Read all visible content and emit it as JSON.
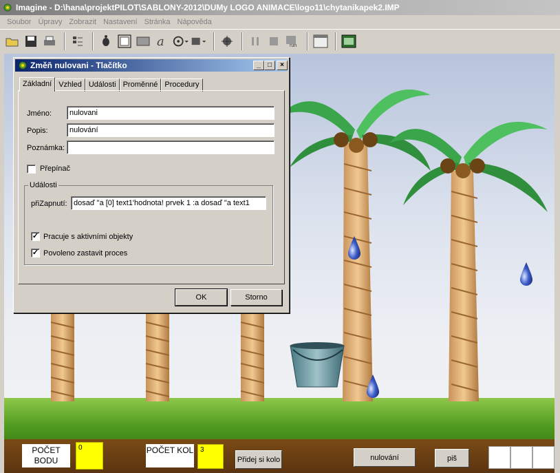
{
  "window": {
    "title": "Imagine - D:\\hana\\projektPILOT\\SABLONY-2012\\DUMy LOGO ANIMACE\\logo11\\chytanikapek2.IMP"
  },
  "menu": [
    "Soubor",
    "Úpravy",
    "Zobrazit",
    "Nastavení",
    "Stránka",
    "Nápověda"
  ],
  "toolbar": {
    "icons": [
      "open-folder-icon",
      "save-icon",
      "print-icon",
      "grid-icon",
      "turtle-icon",
      "frame-icon",
      "rectangle-icon",
      "text-a-icon",
      "film-icon",
      "slider-icon",
      "run-icon",
      "pause-icon",
      "stop-icon",
      "run-label-icon",
      "window-icon",
      "screen-icon"
    ]
  },
  "dialog": {
    "title": "Změň nulovani  - Tlačítko",
    "tabs": [
      "Základní",
      "Vzhled",
      "Události",
      "Proměnné",
      "Procedury"
    ],
    "fields": {
      "name_label": "Jméno:",
      "name_value": "nulovani",
      "desc_label": "Popis:",
      "desc_value": "nulování",
      "note_label": "Poznámka:",
      "note_value": ""
    },
    "switch_label": "Přepínač",
    "events_group": "Události",
    "onpress_label": "přiZapnutí:",
    "onpress_value": "dosaď \"a [0] text1'hodnota! prvek 1 :a dosaď \"a text1",
    "active_objects_label": "Pracuje s aktivními objekty",
    "allow_stop_label": "Povoleno zastavit proces",
    "ok_label": "OK",
    "cancel_label": "Storno"
  },
  "scene": {
    "points_label": "POČET BODU",
    "points_value": "0",
    "rounds_label": "POČET KOL",
    "rounds_value": "3",
    "add_round_button": "Přidej si kolo",
    "reset_button": "nulování",
    "write_button": "piš"
  }
}
